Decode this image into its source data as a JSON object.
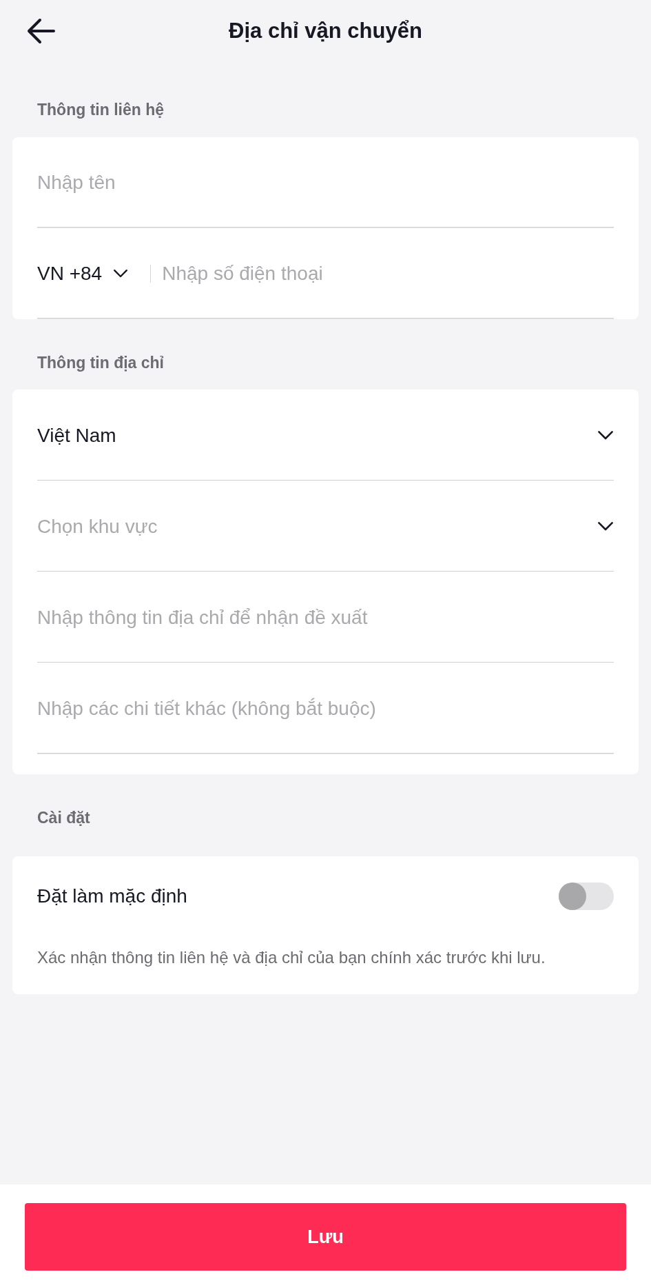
{
  "header": {
    "title": "Địa chỉ vận chuyển"
  },
  "sections": [
    {
      "heading": "Thông tin liên hệ",
      "fields": [
        {
          "kind": "text",
          "placeholder": "Nhập tên"
        },
        {
          "kind": "phone",
          "prefix": "VN +84",
          "placeholder": "Nhập số điện thoại"
        }
      ]
    },
    {
      "heading": "Thông tin địa chỉ",
      "fields": [
        {
          "kind": "select",
          "value": "Việt Nam"
        },
        {
          "kind": "select",
          "placeholder": "Chọn khu vực"
        },
        {
          "kind": "text",
          "placeholder": "Nhập thông tin địa chỉ để nhận đề xuất"
        },
        {
          "kind": "text",
          "placeholder": "Nhập các chi tiết khác (không bắt buộc)"
        }
      ]
    }
  ],
  "settings": {
    "heading": "Cài đặt",
    "toggle": {
      "label": "Đặt làm mặc định",
      "on": false
    },
    "note": "Xác nhận thông tin liên hệ và địa chỉ của bạn chính xác trước khi lưu."
  },
  "save_button": "Lưu"
}
